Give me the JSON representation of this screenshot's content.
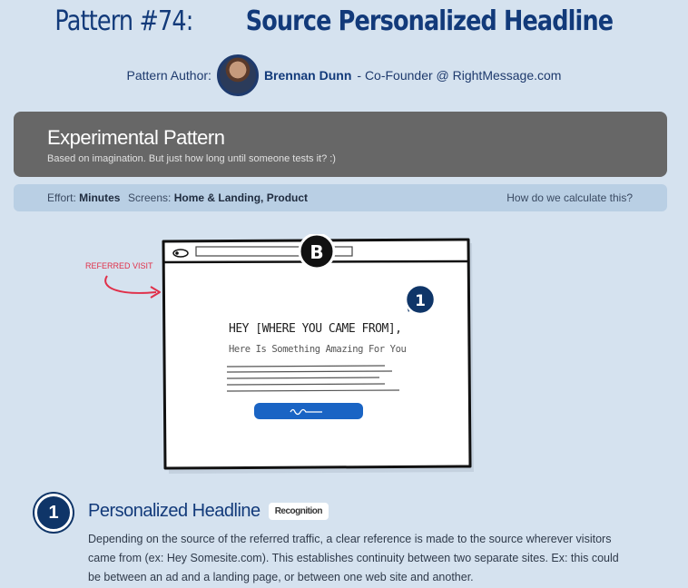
{
  "pattern": {
    "number_label": "Pattern #74:",
    "name": "Source Personalized Headline"
  },
  "author": {
    "prefix": "Pattern Author:",
    "name": "Brennan Dunn",
    "role": "- Co-Founder @ RightMessage.com"
  },
  "banner": {
    "heading": "Experimental Pattern",
    "subtext": "Based on imagination. But just how long until someone tests it? :)"
  },
  "meta": {
    "effort_label": "Effort:",
    "effort_value": "Minutes",
    "screens_label": "Screens:",
    "screens_value": "Home & Landing, Product",
    "calc_link": "How do we calculate this?"
  },
  "illustration": {
    "referred_label": "REFERRED VISIT",
    "badge": "B",
    "marker": "1",
    "headline": "HEY [WHERE YOU CAME FROM],",
    "subheadline": "Here Is Something Amazing For You"
  },
  "items": [
    {
      "number": "1",
      "title": "Personalized Headline",
      "tag": "Recognition",
      "description": "Depending on the source of the referred traffic, a clear reference is made to the source wherever visitors came from (ex: Hey Somesite.com). This establishes continuity between two separate sites. Ex: this could be between an ad and a landing page, or between one web site and another."
    }
  ],
  "colors": {
    "background": "#d5e2ef",
    "navy": "#123a7a",
    "banner": "#676767",
    "meta_bar": "#b9cfe4",
    "accent_red": "#e0304a",
    "cta_blue": "#1a64c4"
  }
}
